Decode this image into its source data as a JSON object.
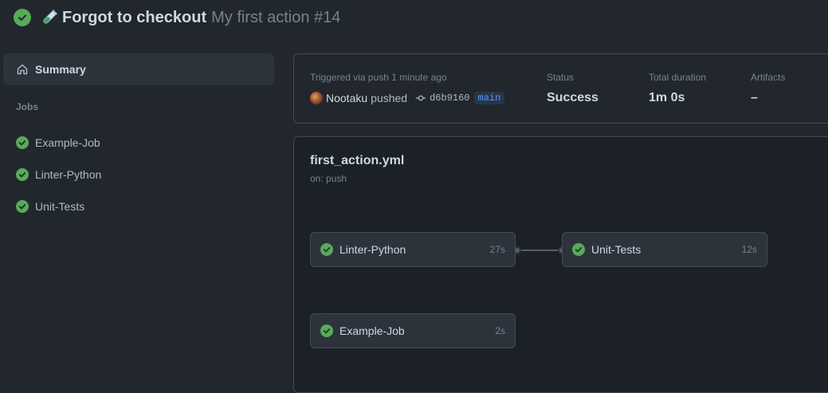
{
  "header": {
    "title": "Forgot to checkout",
    "workflow_run": "My first action #14",
    "status_icon": "check-circle-fill",
    "emoji_icon": "test-tube-emoji"
  },
  "sidebar": {
    "summary_label": "Summary",
    "summary_icon": "home-icon",
    "jobs_heading": "Jobs",
    "jobs": [
      {
        "label": "Example-Job",
        "status": "success"
      },
      {
        "label": "Linter-Python",
        "status": "success"
      },
      {
        "label": "Unit-Tests",
        "status": "success"
      }
    ]
  },
  "run_summary": {
    "trigger_text": "Triggered via push 1 minute ago",
    "actor": "Nootaku",
    "action": "pushed",
    "commit_sha": "d6b9160",
    "branch": "main",
    "status_label": "Status",
    "status_value": "Success",
    "duration_label": "Total duration",
    "duration_value": "1m 0s",
    "artifacts_label": "Artifacts",
    "artifacts_value": "–"
  },
  "workflow": {
    "file": "first_action.yml",
    "trigger": "on: push",
    "jobs": [
      {
        "name": "Linter-Python",
        "duration": "27s",
        "status": "success"
      },
      {
        "name": "Unit-Tests",
        "duration": "12s",
        "status": "success"
      },
      {
        "name": "Example-Job",
        "duration": "2s",
        "status": "success"
      }
    ]
  },
  "colors": {
    "background": "#22272e",
    "success": "#57ab5a",
    "accent": "#539bf5"
  }
}
